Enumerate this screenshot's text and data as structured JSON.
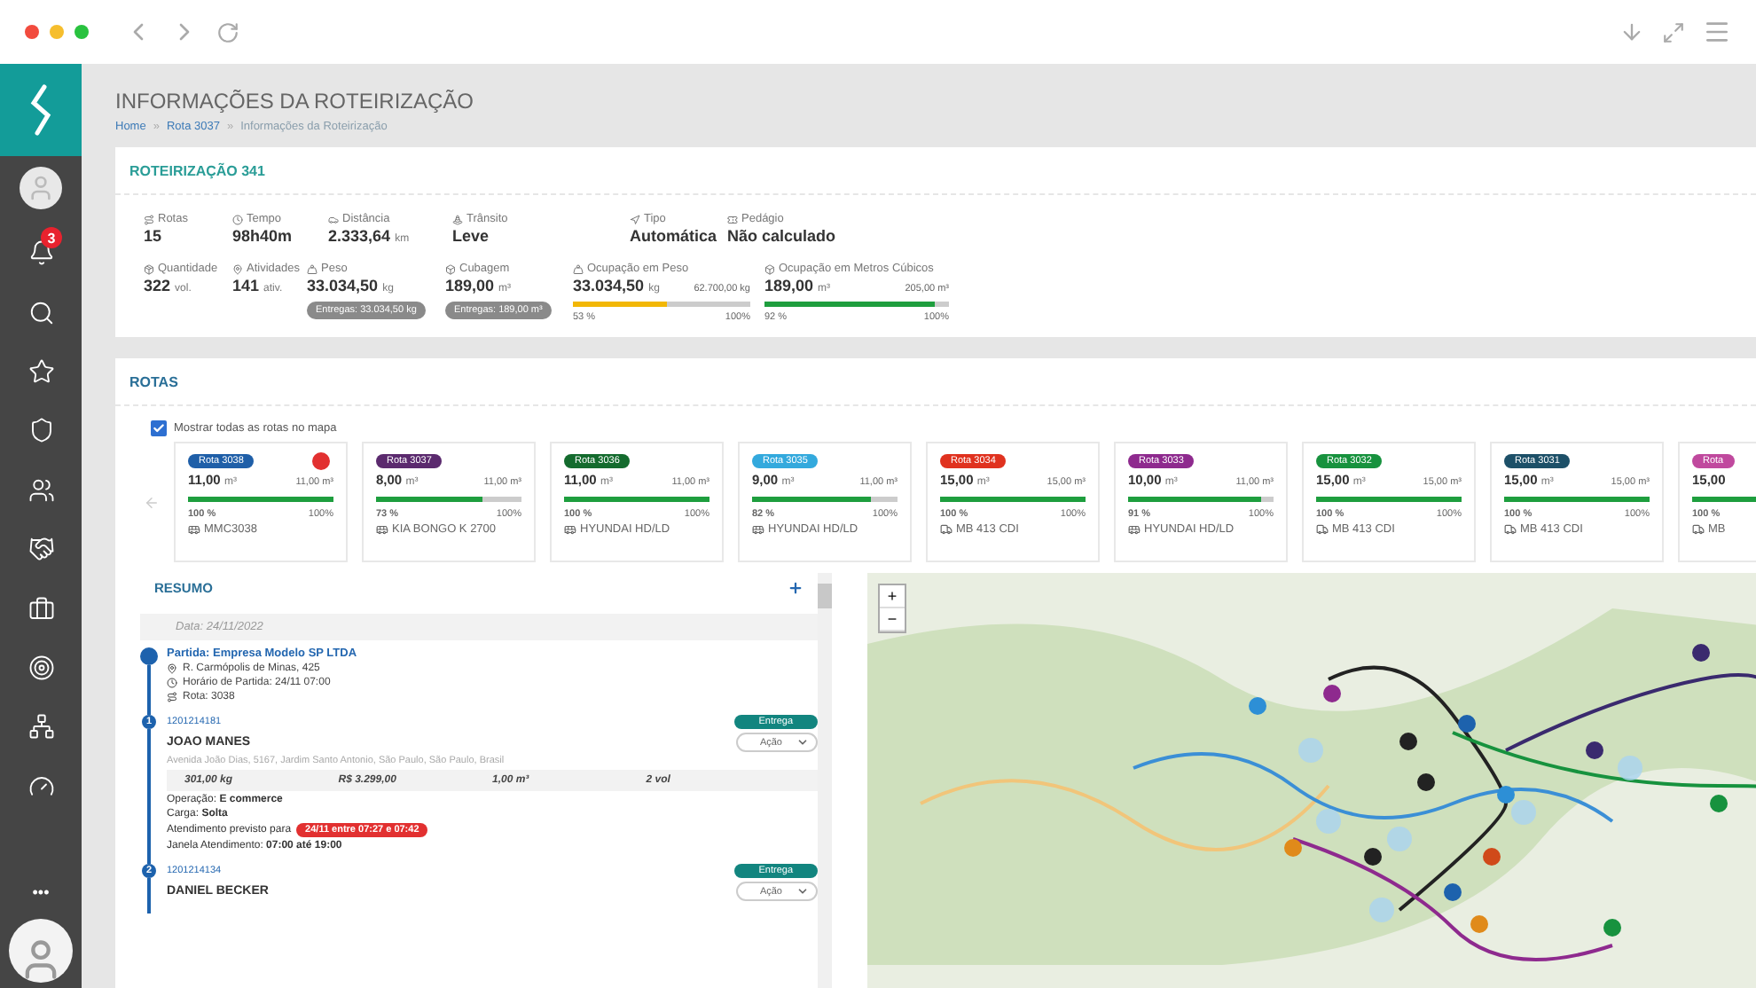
{
  "sidebar": {
    "items": [
      {
        "kind": "bell",
        "badge": "3"
      },
      {
        "kind": "search"
      },
      {
        "kind": "star"
      },
      {
        "kind": "shield"
      },
      {
        "kind": "team"
      },
      {
        "kind": "handshake"
      },
      {
        "kind": "briefcase"
      },
      {
        "kind": "target"
      },
      {
        "kind": "hierarchy"
      },
      {
        "kind": "gauge"
      }
    ],
    "more": "•••"
  },
  "header": {
    "title": "INFORMAÇÕES DA ROTEIRIZAÇÃO",
    "separator": "»",
    "breadcrumb": [
      {
        "label": "Home",
        "current": false
      },
      {
        "label": "Rota 3037",
        "current": false
      },
      {
        "label": "Informações da Roteirização",
        "current": true
      }
    ]
  },
  "summary": {
    "title": "ROTEIRIZAÇÃO 341",
    "stats": [
      {
        "label": "Rotas",
        "value": "15"
      },
      {
        "label": "Tempo",
        "value": "98h40m"
      },
      {
        "label": "Distância",
        "value": "2.333,64",
        "unit": "km"
      },
      {
        "label": "Trânsito",
        "value": "Leve"
      },
      {
        "label": "Tipo",
        "value": "Automática"
      },
      {
        "label": "Pedágio",
        "value": "Não calculado"
      }
    ],
    "stats2": [
      {
        "kind": "plain",
        "label": "Quantidade",
        "value": "322",
        "unit": "vol."
      },
      {
        "kind": "plain",
        "label": "Atividades",
        "value": "141",
        "unit": "ativ."
      },
      {
        "kind": "pill",
        "label": "Peso",
        "value": "33.034,50",
        "unit": "kg",
        "pill": "Entregas: 33.034,50 kg"
      },
      {
        "kind": "pill",
        "label": "Cubagem",
        "value": "189,00",
        "unit": "m³",
        "pill": "Entregas: 189,00 m³"
      },
      {
        "kind": "meter",
        "label": "Ocupação em Peso",
        "value": "33.034,50",
        "unit": "kg",
        "max": "62.700,00 kg",
        "level": 0.53,
        "pct": "53 %",
        "full": "100%",
        "color": "#f2b705"
      },
      {
        "kind": "meter",
        "label": "Ocupação em Metros Cúbicos",
        "value": "189,00",
        "unit": "m³",
        "max": "205,00 m³",
        "level": 0.92,
        "pct": "92 %",
        "full": "100%",
        "color": "#1e9e3e"
      }
    ]
  },
  "routes": {
    "title": "ROTAS",
    "show_all": {
      "label": "Mostrar todas as rotas no mapa",
      "checked": true
    },
    "cards": [
      {
        "badge": "Rota 3038",
        "color": "#1f5fa8",
        "used": "11,00",
        "unit": "m³",
        "cap": "11,00 m³",
        "level": 1,
        "pct": "100 %",
        "full": "100%",
        "vehicle": "MMC3038",
        "kind": "bus",
        "alert": true
      },
      {
        "badge": "Rota 3037",
        "color": "#5b2a6e",
        "used": "8,00",
        "unit": "m³",
        "cap": "11,00 m³",
        "level": 0.73,
        "pct": "73 %",
        "full": "100%",
        "vehicle": "KIA BONGO K 2700",
        "kind": "bus",
        "alert": false
      },
      {
        "badge": "Rota 3036",
        "color": "#146b2e",
        "used": "11,00",
        "unit": "m³",
        "cap": "11,00 m³",
        "level": 1,
        "pct": "100 %",
        "full": "100%",
        "vehicle": "HYUNDAI HD/LD",
        "kind": "bus",
        "alert": false
      },
      {
        "badge": "Rota 3035",
        "color": "#33a9dd",
        "used": "9,00",
        "unit": "m³",
        "cap": "11,00 m³",
        "level": 0.82,
        "pct": "82 %",
        "full": "100%",
        "vehicle": "HYUNDAI HD/LD",
        "kind": "bus",
        "alert": false
      },
      {
        "badge": "Rota 3034",
        "color": "#e0321f",
        "used": "15,00",
        "unit": "m³",
        "cap": "15,00 m³",
        "level": 1,
        "pct": "100 %",
        "full": "100%",
        "vehicle": "MB 413 CDI",
        "kind": "truck",
        "alert": false
      },
      {
        "badge": "Rota 3033",
        "color": "#8e2a8e",
        "used": "10,00",
        "unit": "m³",
        "cap": "11,00 m³",
        "level": 0.91,
        "pct": "91 %",
        "full": "100%",
        "vehicle": "HYUNDAI HD/LD",
        "kind": "bus",
        "alert": false
      },
      {
        "badge": "Rota 3032",
        "color": "#17923e",
        "used": "15,00",
        "unit": "m³",
        "cap": "15,00 m³",
        "level": 1,
        "pct": "100 %",
        "full": "100%",
        "vehicle": "MB 413 CDI",
        "kind": "truck",
        "alert": false
      },
      {
        "badge": "Rota 3031",
        "color": "#1d5068",
        "used": "15,00",
        "unit": "m³",
        "cap": "15,00 m³",
        "level": 1,
        "pct": "100 %",
        "full": "100%",
        "vehicle": "MB 413 CDI",
        "kind": "truck",
        "alert": false
      },
      {
        "badge": "Rota",
        "color": "#c0499e",
        "used": "15,00",
        "level": 1,
        "pct": "100 %",
        "vehicle": "MB",
        "kind": "truck",
        "alert": false
      }
    ]
  },
  "resumo": {
    "title": "RESUMO",
    "date": "Data: 24/11/2022",
    "start": {
      "title": "Partida: Empresa Modelo SP LTDA",
      "address": "R. Carmópolis de Minas, 425",
      "time": "Horário de Partida: 24/11 07:00",
      "route": "Rota: 3038"
    },
    "stops": [
      {
        "number": "1",
        "code": "1201214181",
        "name": "JOAO MANES",
        "tag": "Entrega",
        "action": "Ação",
        "address": "Avenida João Dias, 5167, Jardim Santo Antonio, São Paulo, São Paulo, Brasil",
        "metrics": [
          "301,00 kg",
          "R$ 3.299,00",
          "1,00 m³",
          "2 vol"
        ],
        "operation": "Operação: **E commerce**",
        "cargo": "Carga: **Solta**",
        "forecast": "Atendimento previsto para",
        "forecast_badge": "24/11 entre 07:27 e 07:42",
        "window": "Janela Atendimento: **07:00 até 19:00**"
      },
      {
        "number": "2",
        "code": "1201214134",
        "name": "DANIEL BECKER",
        "tag": "Entrega",
        "action": "Ação"
      }
    ]
  },
  "map": {
    "zoom_in": "+",
    "zoom_out": "−"
  }
}
